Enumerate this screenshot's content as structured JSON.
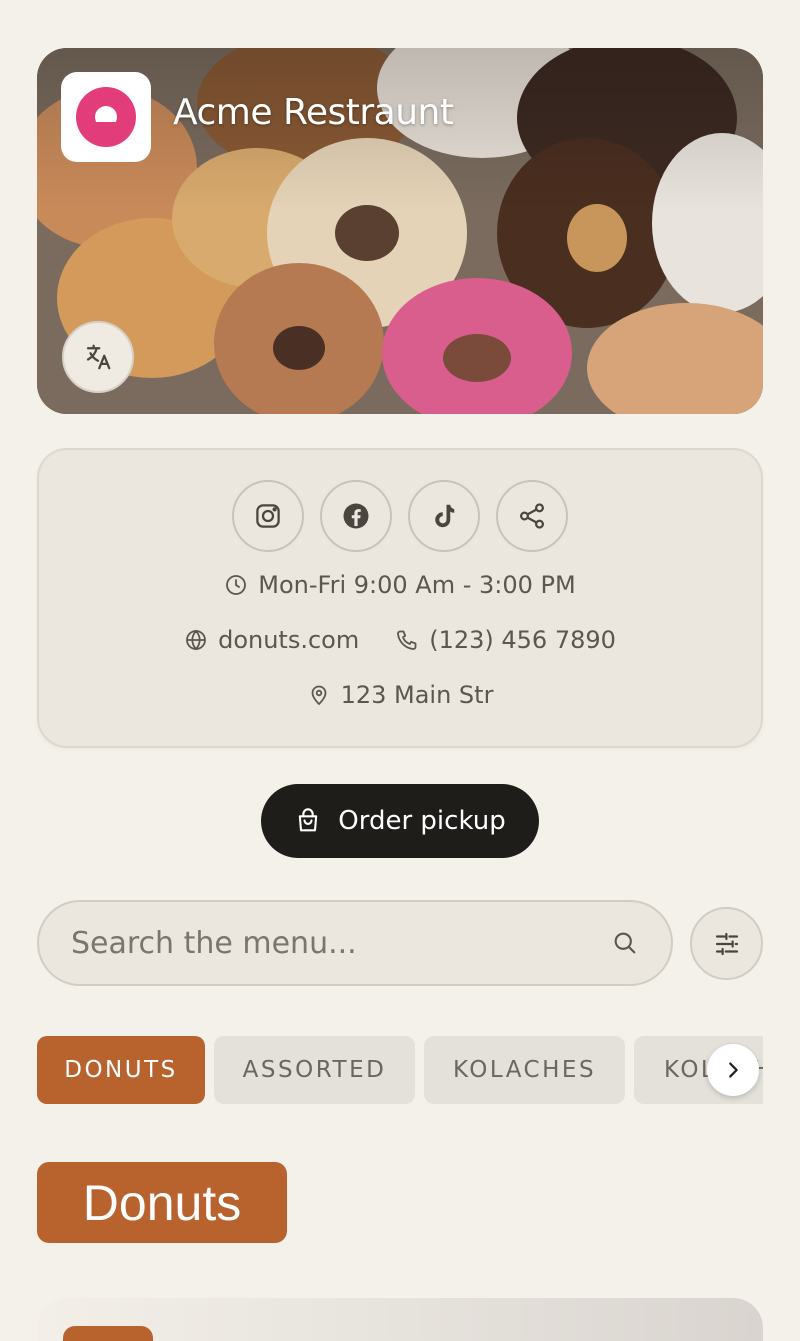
{
  "hero": {
    "title": "Acme Restraunt",
    "logo_text": "Donuts"
  },
  "info": {
    "socials": [
      "instagram-icon",
      "facebook-icon",
      "tiktok-icon",
      "share-icon"
    ],
    "hours": "Mon-Fri 9:00 Am - 3:00 PM",
    "website": "donuts.com",
    "phone": "(123) 456 7890",
    "address": "123 Main Str"
  },
  "order": {
    "label": "Order pickup"
  },
  "search": {
    "placeholder": "Search the menu..."
  },
  "tabs": [
    {
      "label": "DONUTS",
      "active": true
    },
    {
      "label": "ASSORTED",
      "active": false
    },
    {
      "label": "KOLACHES",
      "active": false
    },
    {
      "label": "KOLACHES",
      "active": false
    }
  ],
  "section": {
    "title": "Donuts"
  },
  "colors": {
    "accent": "#b8622e",
    "background": "#f4f1eb",
    "dark": "#1f1d1a"
  }
}
